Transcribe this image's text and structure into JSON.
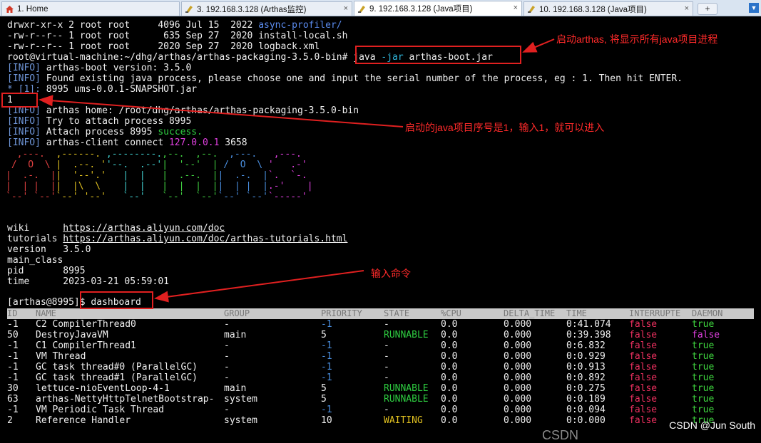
{
  "tabs": [
    {
      "label": "1. Home",
      "active": false,
      "icon": "home-icon"
    },
    {
      "label": "3. 192.168.3.128 (Arthas监控)",
      "active": false,
      "icon": "terminal-icon"
    },
    {
      "label": "9. 192.168.3.128 (Java项目)",
      "active": true,
      "icon": "terminal-icon"
    },
    {
      "label": "10. 192.168.3.128 (Java项目)",
      "active": false,
      "icon": "terminal-icon"
    }
  ],
  "new_tab_label": "+",
  "close_glyph": "×",
  "terminal": {
    "ls_lines": [
      {
        "perm": "drwxr-xr-x 2 root root     4096 Jul 15  2022 ",
        "name": "async-profiler/",
        "dir": true
      },
      {
        "perm": "-rw-r--r-- 1 root root      635 Sep 27  2020 ",
        "name": "install-local.sh",
        "dir": false
      },
      {
        "perm": "-rw-r--r-- 1 root root     2020 Sep 27  2020 ",
        "name": "logback.xml",
        "dir": false
      }
    ],
    "prompt": "root@virtual-machine:~/dhg/arthas/arthas-packaging-3.5.0-bin# ",
    "command_java": "java",
    "command_flag": "-jar",
    "command_rest": " arthas-boot.jar",
    "info_tag": "[INFO]",
    "info_lines": [
      "arthas-boot version: 3.5.0",
      "Found existing java process, please choose one and input the serial number of the process, eg : 1. Then hit ENTER."
    ],
    "process_star": "* [1]:",
    "process_text": " 8995 ums-0.0.1-SNAPSHOT.jar",
    "user_input": "1",
    "info_lines2": [
      "arthas home: /root/dhg/arthas/arthas-packaging-3.5.0-bin",
      "Try to attach process 8995"
    ],
    "attach_text": "Attach process 8995 ",
    "attach_success": "success.",
    "connect_text": "arthas-client connect ",
    "connect_ip": "127.0.0.1",
    "connect_port": " 3658",
    "logo_lines": [
      "  ,---.  ,------. ,--------.,--.  ,--.  ,---.   ,---.",
      " /  O  \\ |  .--. ''--.  .--'|  '--'  | /  O  \\ '   .-'",
      "|  .-.  ||  '--'.'   |  |   |  .--.  ||  .-.  |`.  `-.",
      "|  | |  ||  |\\  \\    |  |   |  |  |  ||  | |  |.-'    |",
      "`--' `--'`--' '--'   `--'   `--'  `--'`--' `--'`-----'"
    ],
    "info_rows": [
      {
        "key": "wiki      ",
        "value": "https://arthas.aliyun.com/doc",
        "link": true
      },
      {
        "key": "tutorials ",
        "value": "https://arthas.aliyun.com/doc/arthas-tutorials.html",
        "link": true
      },
      {
        "key": "version   ",
        "value": "3.5.0",
        "link": false
      },
      {
        "key": "main_class",
        "value": "",
        "link": false
      },
      {
        "key": "pid       ",
        "value": "8995",
        "link": false
      },
      {
        "key": "time      ",
        "value": "2023-03-21 05:59:01",
        "link": false
      }
    ],
    "arthas_prompt": "[arthas@8995]$ ",
    "arthas_command": "dashboard"
  },
  "dashboard": {
    "columns": [
      "ID",
      "NAME",
      "GROUP",
      "PRIORITY",
      "STATE",
      "%CPU",
      "DELTA_TIME",
      "TIME",
      "INTERRUPTE",
      "DAEMON"
    ],
    "rows": [
      [
        "-1",
        "C2 CompilerThread0",
        "-",
        "-1",
        "-",
        "0.0",
        "0.000",
        "0:41.074",
        "false",
        "true"
      ],
      [
        "50",
        "DestroyJavaVM",
        "main",
        "5",
        "RUNNABLE",
        "0.0",
        "0.000",
        "0:39.398",
        "false",
        "false"
      ],
      [
        "-1",
        "C1 CompilerThread1",
        "-",
        "-1",
        "-",
        "0.0",
        "0.000",
        "0:6.832",
        "false",
        "true"
      ],
      [
        "-1",
        "VM Thread",
        "-",
        "-1",
        "-",
        "0.0",
        "0.000",
        "0:0.929",
        "false",
        "true"
      ],
      [
        "-1",
        "GC task thread#0 (ParallelGC)",
        "-",
        "-1",
        "-",
        "0.0",
        "0.000",
        "0:0.913",
        "false",
        "true"
      ],
      [
        "-1",
        "GC task thread#1 (ParallelGC)",
        "-",
        "-1",
        "-",
        "0.0",
        "0.000",
        "0:0.892",
        "false",
        "true"
      ],
      [
        "30",
        "lettuce-nioEventLoop-4-1",
        "main",
        "5",
        "RUNNABLE",
        "0.0",
        "0.000",
        "0:0.275",
        "false",
        "true"
      ],
      [
        "63",
        "arthas-NettyHttpTelnetBootstrap-",
        "system",
        "5",
        "RUNNABLE",
        "0.0",
        "0.000",
        "0:0.189",
        "false",
        "true"
      ],
      [
        "-1",
        "VM Periodic Task Thread",
        "-",
        "-1",
        "-",
        "0.0",
        "0.000",
        "0:0.094",
        "false",
        "true"
      ],
      [
        "2",
        "Reference Handler",
        "system",
        "10",
        "WAITING",
        "0.0",
        "0.000",
        "0:0.000",
        "false",
        "true"
      ]
    ]
  },
  "annotations": {
    "start": "启动arthas, 将显示所有java项目进程",
    "select": "启动的java项目序号是1，输入1，就可以进入",
    "command": "输入命令"
  },
  "watermark": "CSDN @Jun South",
  "watermark_bg": "CSDN"
}
